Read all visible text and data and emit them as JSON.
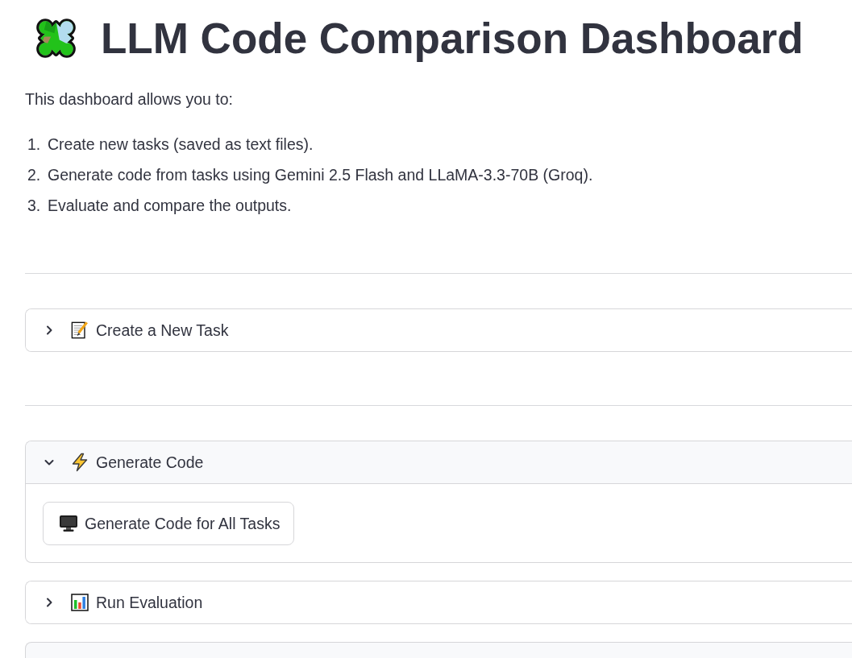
{
  "title": {
    "text": "LLM Code Comparison Dashboard"
  },
  "intro": "This dashboard allows you to:",
  "steps": [
    {
      "number": "1.",
      "text": "Create new tasks (saved as text files)."
    },
    {
      "number": "2.",
      "text": "Generate code from tasks using Gemini 2.5 Flash and LLaMA-3.3-70B (Groq)."
    },
    {
      "number": "3.",
      "text": "Evaluate and compare the outputs."
    }
  ],
  "sections": [
    {
      "kind": "divider"
    },
    {
      "kind": "expander",
      "label": "Create a New Task",
      "expanded": false
    },
    {
      "kind": "divider"
    },
    {
      "kind": "expander",
      "label": "Generate Code",
      "expanded": true,
      "buttons": [
        "Generate Code for All Tasks"
      ]
    },
    {
      "kind": "expander",
      "label": "Run Evaluation",
      "expanded": false
    },
    {
      "kind": "expander",
      "expanded": true
    }
  ]
}
